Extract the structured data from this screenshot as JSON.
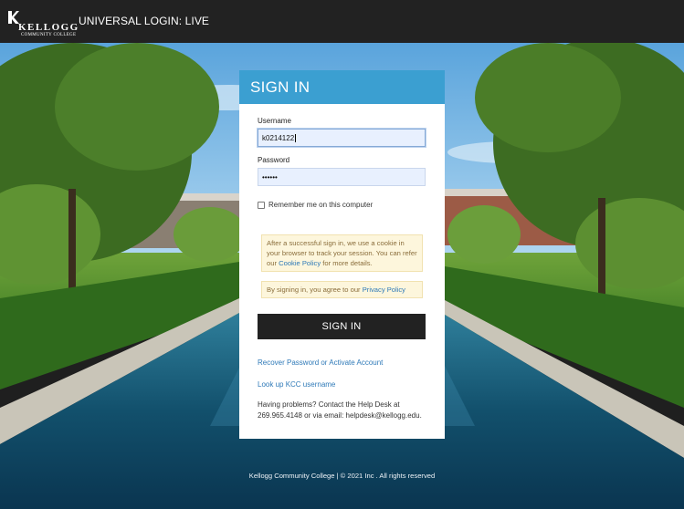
{
  "header": {
    "logo_word": "KELLOGG",
    "logo_sub": "COMMUNITY COLLEGE",
    "title": "UNIVERSAL LOGIN: LIVE"
  },
  "login": {
    "heading": "SIGN IN",
    "username_label": "Username",
    "username_value": "k0214122",
    "password_label": "Password",
    "password_value": "••••••",
    "remember_label": "Remember me on this computer",
    "remember_checked": false,
    "cookie_notice": {
      "text": "After a successful sign in, we use a cookie in your browser to track your session. You can refer our",
      "link": "Cookie Policy",
      "after": "for more details."
    },
    "privacy_notice": {
      "text": "By signing in, you agree to our",
      "link": "Privacy Policy"
    },
    "submit_label": "SIGN IN",
    "recover_link": "Recover Password or Activate Account",
    "lookup_link": "Look up KCC username",
    "help_text": "Having problems? Contact the Help Desk at 269.965.4148 or via email: helpdesk@kellogg.edu."
  },
  "footer": {
    "text": "Kellogg Community College | © 2021 Inc . All rights reserved"
  },
  "colors": {
    "topbar": "#222222",
    "accent": "#3b9fd1",
    "button": "#222222",
    "link": "#2f7ab8"
  }
}
